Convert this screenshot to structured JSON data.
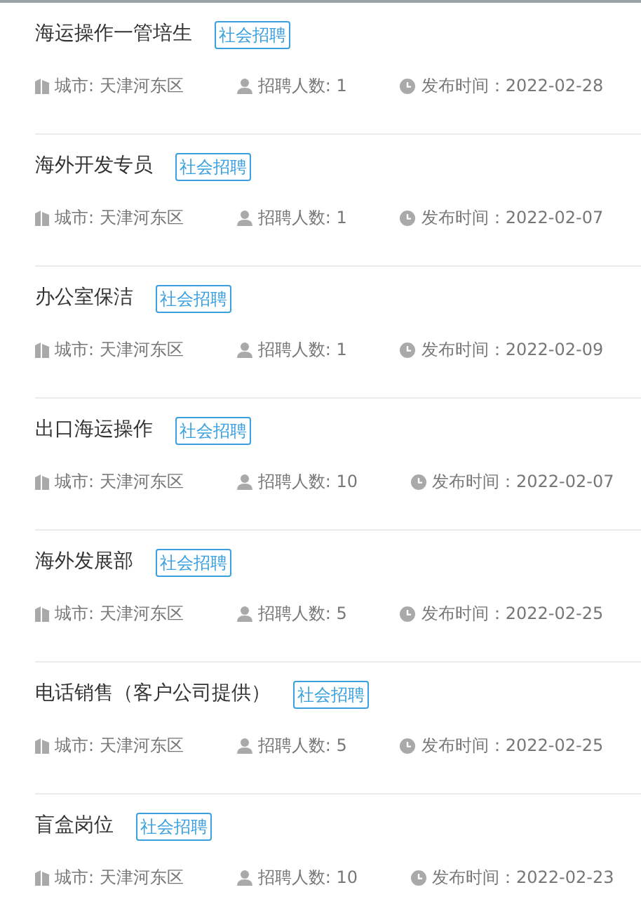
{
  "jobs": [
    {
      "title": "海运操作一管培生",
      "tag": "社会招聘",
      "city": "城市: 天津河东区",
      "count": "招聘人数: 1",
      "date": "发布时间：2022-02-28"
    },
    {
      "title": "海外开发专员",
      "tag": "社会招聘",
      "city": "城市: 天津河东区",
      "count": "招聘人数: 1",
      "date": "发布时间：2022-02-07"
    },
    {
      "title": "办公室保洁",
      "tag": "社会招聘",
      "city": "城市: 天津河东区",
      "count": "招聘人数: 1",
      "date": "发布时间：2022-02-09"
    },
    {
      "title": "出口海运操作",
      "tag": "社会招聘",
      "city": "城市: 天津河东区",
      "count": "招聘人数: 10",
      "date": "发布时间：2022-02-07"
    },
    {
      "title": "海外发展部",
      "tag": "社会招聘",
      "city": "城市: 天津河东区",
      "count": "招聘人数: 5",
      "date": "发布时间：2022-02-25"
    },
    {
      "title": "电话销售（客户公司提供）",
      "tag": "社会招聘",
      "city": "城市: 天津河东区",
      "count": "招聘人数: 5",
      "date": "发布时间：2022-02-25"
    },
    {
      "title": "盲盒岗位",
      "tag": "社会招聘",
      "city": "城市: 天津河东区",
      "count": "招聘人数: 10",
      "date": "发布时间：2022-02-23"
    }
  ]
}
